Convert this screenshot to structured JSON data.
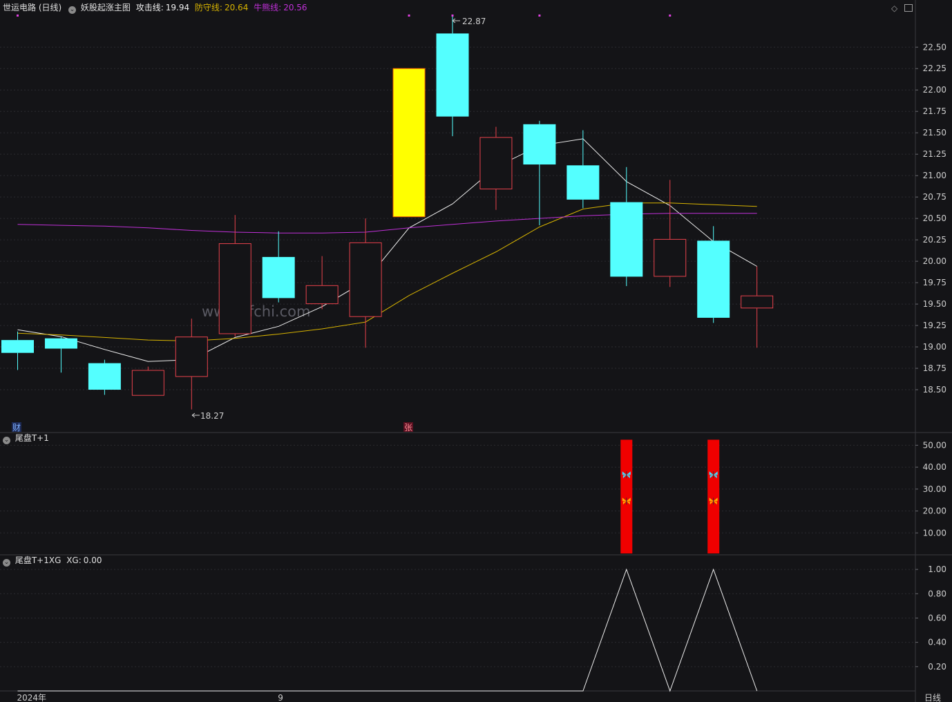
{
  "header": {
    "stock": "世运电路 (日线)",
    "indicator": "妖股起涨主图",
    "attack_label": "攻击线:",
    "attack_value": "19.94",
    "defense_label": "防守线:",
    "defense_value": "20.64",
    "bull_label": "牛熊线:",
    "bull_value": "20.56"
  },
  "colors": {
    "bg": "#141417",
    "up": "#e8424c",
    "down": "#54ffff",
    "attack": "#f0f0f0",
    "defense": "#d8b400",
    "bull": "#c030d8",
    "highlight": "#ffff00",
    "grid": "#2b2b30",
    "axis_text": "#cfcfcf",
    "bar": "#f00000",
    "zigzag": "#f0f0f0"
  },
  "markers": {
    "cai": "财",
    "zhang": "张",
    "high": "22.87",
    "low": "18.27"
  },
  "watermark": "www.cfchi.com",
  "panel2": {
    "title": "尾盘T+1"
  },
  "panel3": {
    "title": "尾盘T+1XG",
    "xg_label": "XG:",
    "xg_value": "0.00"
  },
  "xaxis": {
    "labels": [
      {
        "text": "2024年",
        "index": 0
      },
      {
        "text": "9",
        "index": 6
      }
    ],
    "period": "日线"
  },
  "icons": {
    "panel_toggle": "chevron-down-icon",
    "butterfly": "butterfly-icon",
    "settings": "diamond-icon",
    "window": "window-icon"
  },
  "chart_data": [
    {
      "type": "candlestick",
      "title": "妖股起涨主图",
      "yticks": [
        18.5,
        18.75,
        19.0,
        19.25,
        19.5,
        19.75,
        20.0,
        20.25,
        20.5,
        20.75,
        21.0,
        21.25,
        21.5,
        21.75,
        22.0,
        22.25,
        22.5
      ],
      "ylim": [
        18.0,
        22.97
      ],
      "candles": [
        {
          "open": 19.08,
          "close": 18.93,
          "high": 19.18,
          "low": 18.73
        },
        {
          "open": 19.1,
          "close": 18.98,
          "high": 19.12,
          "low": 18.7
        },
        {
          "open": 18.81,
          "close": 18.5,
          "high": 18.85,
          "low": 18.44
        },
        {
          "open": 18.43,
          "close": 18.73,
          "high": 18.77,
          "low": 18.43
        },
        {
          "open": 18.65,
          "close": 19.12,
          "high": 19.33,
          "low": 18.27
        },
        {
          "open": 19.15,
          "close": 20.21,
          "high": 20.54,
          "low": 19.12
        },
        {
          "open": 20.05,
          "close": 19.57,
          "high": 20.35,
          "low": 19.52
        },
        {
          "open": 19.5,
          "close": 19.72,
          "high": 20.06,
          "low": 19.44
        },
        {
          "open": 19.35,
          "close": 20.22,
          "high": 20.5,
          "low": 18.99
        },
        {
          "open": 20.52,
          "close": 22.25,
          "high": 22.25,
          "low": 20.52,
          "highlight": true
        },
        {
          "open": 22.66,
          "close": 21.69,
          "high": 22.87,
          "low": 21.46
        },
        {
          "open": 20.84,
          "close": 21.45,
          "high": 21.57,
          "low": 20.6
        },
        {
          "open": 21.6,
          "close": 21.13,
          "high": 21.64,
          "low": 20.42
        },
        {
          "open": 21.12,
          "close": 20.72,
          "high": 21.53,
          "low": 20.62
        },
        {
          "open": 20.69,
          "close": 19.82,
          "high": 21.1,
          "low": 19.71
        },
        {
          "open": 19.82,
          "close": 20.26,
          "high": 20.95,
          "low": 19.7
        },
        {
          "open": 20.24,
          "close": 19.34,
          "high": 20.41,
          "low": 19.28
        },
        {
          "open": 19.45,
          "close": 19.6,
          "high": 19.94,
          "low": 18.99
        }
      ],
      "series": [
        {
          "name": "攻击线",
          "values": [
            19.2,
            19.12,
            18.97,
            18.83,
            18.85,
            19.11,
            19.24,
            19.47,
            19.77,
            20.39,
            20.67,
            21.1,
            21.35,
            21.43,
            20.93,
            20.65,
            20.23,
            19.94
          ]
        },
        {
          "name": "防守线",
          "values": [
            19.16,
            19.14,
            19.11,
            19.08,
            19.07,
            19.1,
            19.15,
            19.21,
            19.29,
            19.6,
            19.86,
            20.11,
            20.4,
            20.61,
            20.68,
            20.68,
            20.66,
            20.64
          ]
        },
        {
          "name": "牛熊线",
          "values": [
            20.43,
            20.42,
            20.41,
            20.39,
            20.36,
            20.34,
            20.33,
            20.33,
            20.34,
            20.39,
            20.43,
            20.47,
            20.5,
            20.53,
            20.55,
            20.56,
            20.56,
            20.56
          ]
        }
      ]
    },
    {
      "type": "bar",
      "title": "尾盘T+1",
      "yticks": [
        10,
        20,
        30,
        40,
        50
      ],
      "ylim": [
        0,
        55.8
      ],
      "values": [
        0,
        0,
        0,
        0,
        0,
        0,
        0,
        0,
        0,
        0,
        0,
        0,
        0,
        0,
        50,
        0,
        50,
        0
      ],
      "butterflies_at": [
        36.5,
        24.5
      ]
    },
    {
      "type": "line",
      "title": "尾盘T+1XG",
      "yticks": [
        0.2,
        0.4,
        0.6,
        0.8,
        1.0
      ],
      "ylim": [
        0,
        1.12
      ],
      "series": [
        {
          "name": "XG",
          "values": [
            0,
            0,
            0,
            0,
            0,
            0,
            0,
            0,
            0,
            0,
            0,
            0,
            0,
            0,
            1,
            0,
            1,
            0
          ]
        }
      ]
    }
  ]
}
